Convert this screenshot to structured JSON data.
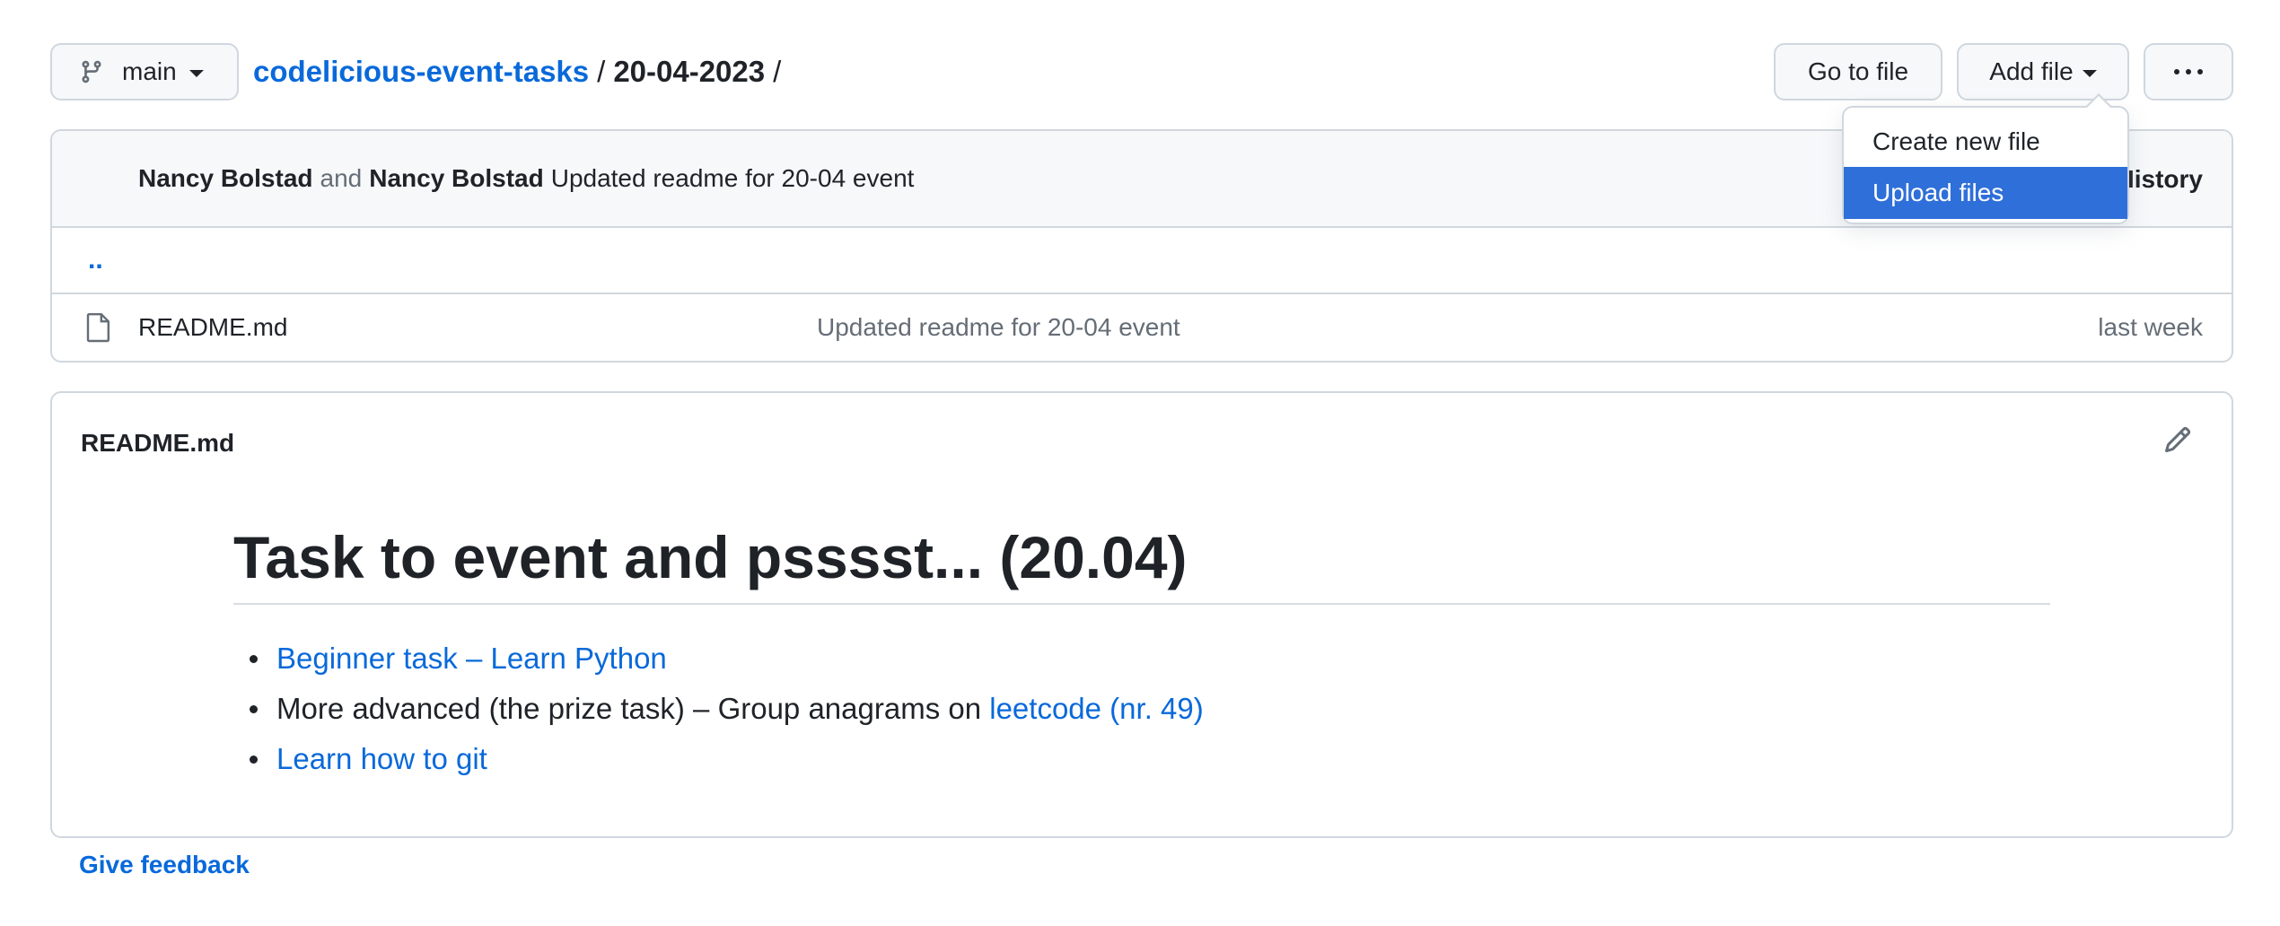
{
  "toolbar": {
    "branch_label": "main",
    "repo_link": "codelicious-event-tasks",
    "path_sep1": "/",
    "current_dir": "20-04-2023",
    "path_sep2": "/",
    "goto_label": "Go to file",
    "addfile_label": "Add file",
    "more_icon": "kebab-horizontal-icon"
  },
  "add_file_menu": {
    "items": [
      {
        "label": "Create new file",
        "selected": false
      },
      {
        "label": "Upload files",
        "selected": true
      }
    ],
    "selected_color": "#2f6fd9"
  },
  "commit": {
    "author1": "Nancy Bolstad",
    "and": "and",
    "author2": "Nancy Bolstad",
    "message": "Updated readme for 20-04 event",
    "history_label": "History"
  },
  "files": {
    "parent_link": "..",
    "rows": [
      {
        "icon": "file-icon",
        "name": "README.md",
        "message": "Updated readme for 20-04 event",
        "date": "last week"
      }
    ]
  },
  "readme": {
    "title": "README.md",
    "edit_icon": "pencil-icon",
    "heading": "Task to event and psssst... (20.04)",
    "items": [
      {
        "link": "Beginner task – Learn Python"
      },
      {
        "prefix": "More advanced (the prize task) – Group anagrams on ",
        "link": "leetcode (nr. 49)"
      },
      {
        "link": "Learn how to git"
      }
    ]
  },
  "footer": {
    "feedback": "Give feedback"
  },
  "colors": {
    "link": "#0969da",
    "border": "#d0d7de",
    "header_bg": "#f6f8fa"
  }
}
